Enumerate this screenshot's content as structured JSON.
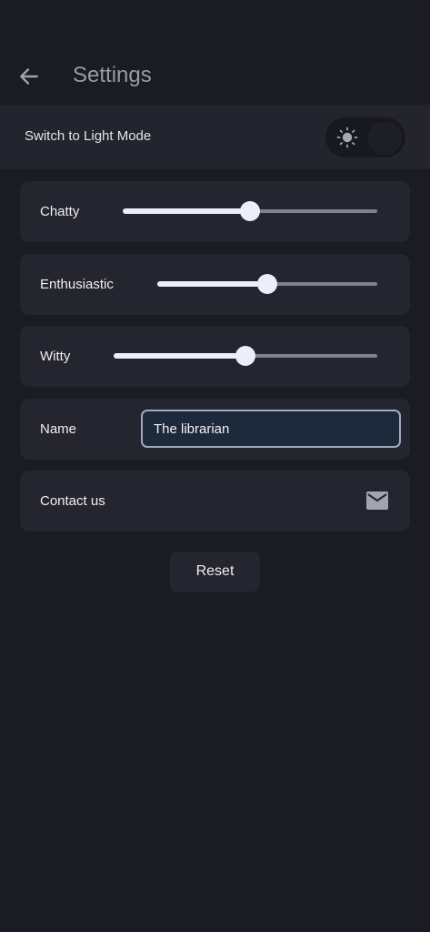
{
  "header": {
    "title": "Settings",
    "back_icon": "arrow-left-icon"
  },
  "theme": {
    "label": "Switch to Light Mode",
    "toggle_icon": "sun-icon",
    "toggle_on": false
  },
  "sliders": [
    {
      "label": "Chatty",
      "value": 0.5
    },
    {
      "label": "Enthusiastic",
      "value": 0.5
    },
    {
      "label": "Witty",
      "value": 0.5
    }
  ],
  "name_field": {
    "label": "Name",
    "value": "The librarian"
  },
  "contact": {
    "label": "Contact us",
    "icon": "mail-icon"
  },
  "reset_label": "Reset",
  "colors": {
    "background": "#1b1b23",
    "card": "#24252f",
    "accent": "#eceefa",
    "input_border": "#a4a9be",
    "input_bg": "#1d2a3c"
  }
}
